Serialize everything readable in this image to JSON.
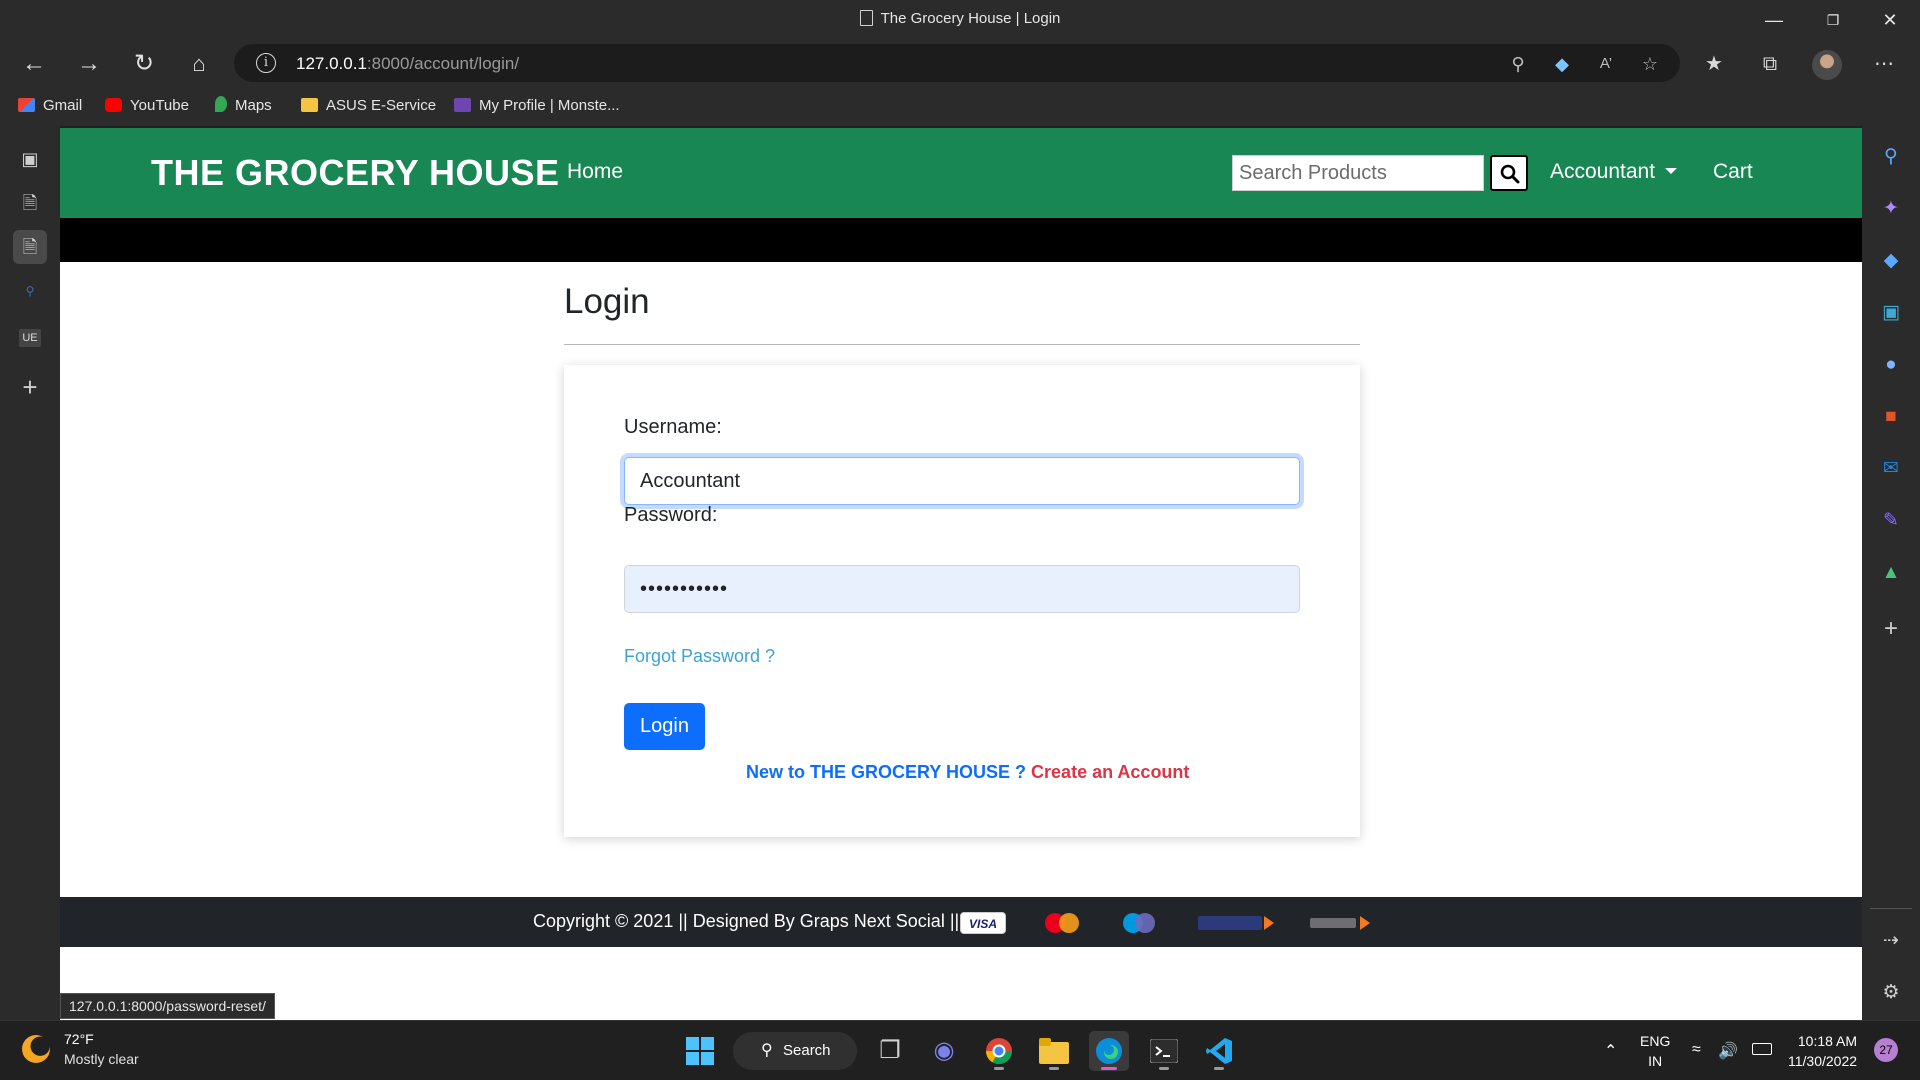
{
  "browser": {
    "window_title": "The Grocery House | Login",
    "url_host": "127.0.0.1",
    "url_path": ":8000/account/login/",
    "bookmarks": [
      {
        "label": "Gmail"
      },
      {
        "label": "YouTube"
      },
      {
        "label": "Maps"
      },
      {
        "label": "ASUS E-Service"
      },
      {
        "label": "My Profile | Monste..."
      }
    ],
    "left_rail": {
      "ue_label": "UE"
    },
    "status_url": "127.0.0.1:8000/password-reset/"
  },
  "site": {
    "brand": "THE GROCERY HOUSE",
    "nav_home": "Home",
    "search_placeholder": "Search Products",
    "user_menu": "Accountant",
    "cart": "Cart",
    "accent_color": "#198754"
  },
  "login": {
    "heading": "Login",
    "username_label": "Username:",
    "username_value": "Accountant",
    "password_label": "Password:",
    "password_value": "•••••••••••",
    "forgot_link": "Forgot Password ?",
    "login_button": "Login",
    "new_to_text": "New to THE GROCERY HOUSE ?",
    "create_account": "Create an Account"
  },
  "footer": {
    "copyright": "Copyright © 2021 || Designed By Graps Next Social ||",
    "payment_icons": [
      "visa-logo",
      "mastercard-logo",
      "maestro-logo",
      "rupay-logo",
      "upi-logo"
    ]
  },
  "taskbar": {
    "temperature": "72°F",
    "condition": "Mostly clear",
    "search_label": "Search",
    "lang_line1": "ENG",
    "lang_line2": "IN",
    "time": "10:18 AM",
    "date": "11/30/2022",
    "notification_count": "27"
  }
}
